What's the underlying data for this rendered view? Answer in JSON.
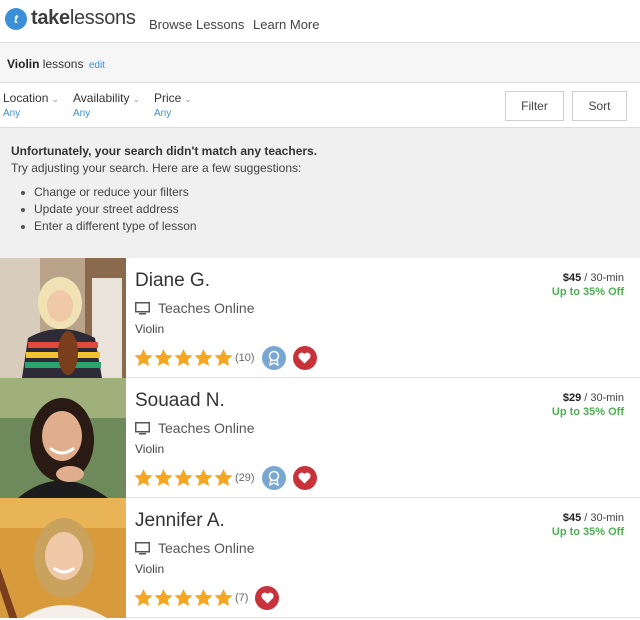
{
  "brand": {
    "mark": "t",
    "name_bold": "take",
    "name_rest": "lessons"
  },
  "nav": {
    "browse": "Browse Lessons",
    "learn": "Learn More"
  },
  "search": {
    "instrument": "Violin",
    "suffix": " lessons",
    "edit": "edit"
  },
  "filters": [
    {
      "label": "Location",
      "value": "Any"
    },
    {
      "label": "Availability",
      "value": "Any"
    },
    {
      "label": "Price",
      "value": "Any"
    }
  ],
  "buttons": {
    "filter": "Filter",
    "sort": "Sort"
  },
  "notice": {
    "title": "Unfortunately, your search didn't match any teachers.",
    "subtitle": "Try adjusting your search. Here are a few suggestions:",
    "suggestions": [
      "Change or reduce your filters",
      "Update your street address",
      "Enter a different type of lesson"
    ]
  },
  "teachers": [
    {
      "name": "Diane G.",
      "online": "Teaches Online",
      "instrument": "Violin",
      "rating": 5,
      "count": "(10)",
      "has_award": true,
      "price": "$45",
      "per": " / 30-min",
      "discount": "Up to 35% Off"
    },
    {
      "name": "Souaad N.",
      "online": "Teaches Online",
      "instrument": "Violin",
      "rating": 5,
      "count": "(29)",
      "has_award": true,
      "price": "$29",
      "per": " / 30-min",
      "discount": "Up to 35% Off"
    },
    {
      "name": "Jennifer A.",
      "online": "Teaches Online",
      "instrument": "Violin",
      "rating": 5,
      "count": "(7)",
      "has_award": false,
      "price": "$45",
      "per": " / 30-min",
      "discount": "Up to 35% Off"
    }
  ],
  "colors": {
    "accent": "#3a8fd6",
    "star": "#f5a623",
    "discount": "#4caf50",
    "favorite": "#c8323a",
    "award": "#79a7d1"
  }
}
